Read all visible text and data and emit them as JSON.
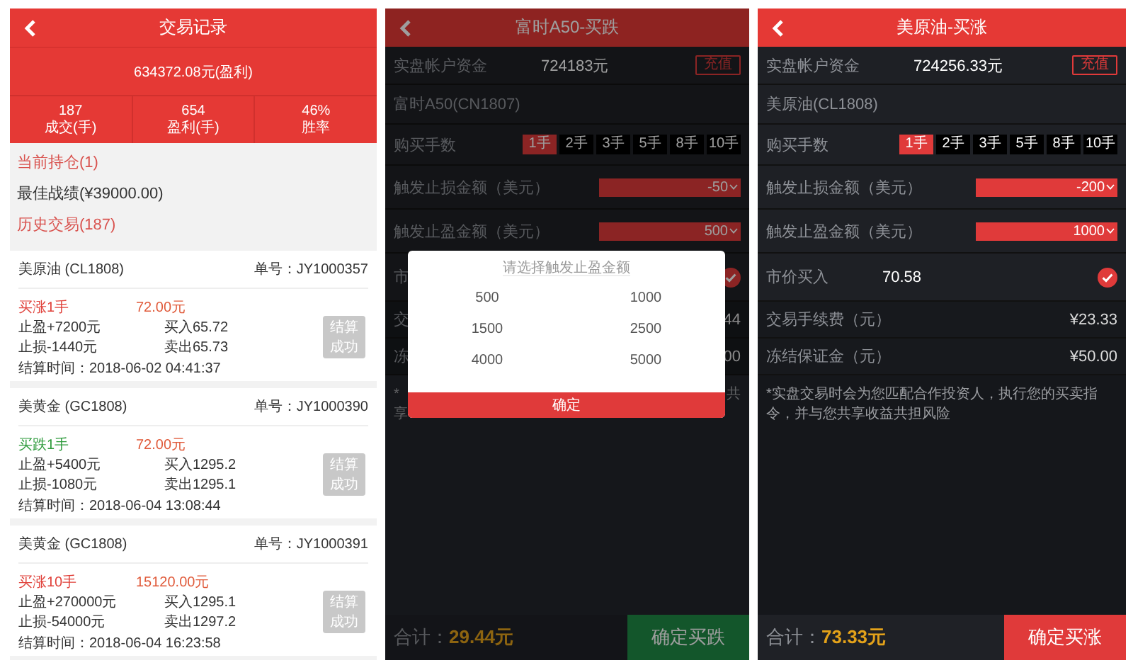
{
  "history": {
    "title": "交易记录",
    "total": "634372.08元(盈利)",
    "stats": [
      {
        "value": "187",
        "label": "成交(手)"
      },
      {
        "value": "654",
        "label": "盈利(手)"
      },
      {
        "value": "46%",
        "label": "胜率"
      }
    ],
    "links": [
      {
        "text": "当前持仓(1)",
        "kind": "link"
      },
      {
        "text": "最佳战绩(¥39000.00)",
        "kind": "plain"
      },
      {
        "text": "历史交易(187)",
        "kind": "link"
      }
    ],
    "orders": [
      {
        "product": "美原油 (CL1808)",
        "order_no": "单号：JY1000357",
        "direction": "买涨1手",
        "kind": "up",
        "amount": "72.00元",
        "take_profit": "止盈+7200元",
        "buy": "买入65.72",
        "stop_loss": "止损-1440元",
        "sell": "卖出65.73",
        "status": "结算成功",
        "settle_time": "结算时间：2018-06-02 04:41:37"
      },
      {
        "product": "美黄金 (GC1808)",
        "order_no": "单号：JY1000390",
        "direction": "买跌1手",
        "kind": "down",
        "amount": "72.00元",
        "take_profit": "止盈+5400元",
        "buy": "买入1295.2",
        "stop_loss": "止损-1080元",
        "sell": "卖出1295.1",
        "status": "结算成功",
        "settle_time": "结算时间：2018-06-04 13:08:44"
      },
      {
        "product": "美黄金 (GC1808)",
        "order_no": "单号：JY1000391",
        "direction": "买涨10手",
        "kind": "up",
        "amount": "15120.00元",
        "take_profit": "止盈+270000元",
        "buy": "买入1295.1",
        "stop_loss": "止损-54000元",
        "sell": "卖出1297.2",
        "status": "结算成功",
        "settle_time": "结算时间：2018-06-04 16:23:58"
      }
    ]
  },
  "forms": [
    {
      "title": "富时A50-买跌",
      "rows": [
        {
          "kind": "balance",
          "label": "实盘帐户资金",
          "value": "724183元",
          "button": "充值"
        },
        {
          "kind": "product",
          "label": "富时A50(CN1807)"
        },
        {
          "kind": "lots",
          "label": "购买手数",
          "options": [
            {
              "label": "1手",
              "selected": true
            },
            {
              "label": "2手",
              "selected": false
            },
            {
              "label": "3手",
              "selected": false
            },
            {
              "label": "5手",
              "selected": false
            },
            {
              "label": "8手",
              "selected": false
            },
            {
              "label": "10手",
              "selected": false
            }
          ]
        },
        {
          "kind": "select",
          "label": "触发止损金额（美元）",
          "value": "-50"
        },
        {
          "kind": "select",
          "label": "触发止盈金额（美元）",
          "value": "500"
        },
        {
          "kind": "market",
          "label": "市",
          "checked": true
        },
        {
          "kind": "info",
          "label": "交",
          "value": "44"
        },
        {
          "kind": "info",
          "label": "冻",
          "value": "00"
        },
        {
          "kind": "note_partial",
          "lines": [
            {
              "left": "*",
              "right": "共"
            },
            {
              "left": "享"
            }
          ]
        }
      ],
      "modal": {
        "title": "请选择触发止盈金额",
        "options": [
          {
            "label": "500",
            "selected": false
          },
          {
            "label": "1000",
            "selected": false
          },
          {
            "label": "1500",
            "selected": false
          },
          {
            "label": "2500",
            "selected": false
          },
          {
            "label": "4000",
            "selected": false
          },
          {
            "label": "5000",
            "selected": false
          }
        ],
        "button": "确定"
      },
      "footer": {
        "total_label": "合计：",
        "total": "29.44元",
        "button": "确定买跌",
        "kind": "fall"
      }
    },
    {
      "title": "美原油-买涨",
      "rows": [
        {
          "kind": "balance",
          "label": "实盘帐户资金",
          "value": "724256.33元",
          "button": "充值"
        },
        {
          "kind": "product",
          "label": "美原油(CL1808)"
        },
        {
          "kind": "lots",
          "label": "购买手数",
          "options": [
            {
              "label": "1手",
              "selected": true
            },
            {
              "label": "2手",
              "selected": false
            },
            {
              "label": "3手",
              "selected": false
            },
            {
              "label": "5手",
              "selected": false
            },
            {
              "label": "8手",
              "selected": false
            },
            {
              "label": "10手",
              "selected": false
            }
          ]
        },
        {
          "kind": "select",
          "label": "触发止损金额（美元）",
          "value": "-200"
        },
        {
          "kind": "select",
          "label": "触发止盈金额（美元）",
          "value": "1000"
        },
        {
          "kind": "market",
          "label": "市价买入",
          "value": "70.58",
          "checked": true
        },
        {
          "kind": "info",
          "label": "交易手续费（元）",
          "value": "¥23.33"
        },
        {
          "kind": "info",
          "label": "冻结保证金（元）",
          "value": "¥50.00"
        },
        {
          "kind": "note",
          "text": "*实盘交易时会为您匹配合作投资人，执行您的买卖指令，并与您共享收益共担风险"
        }
      ],
      "footer": {
        "total_label": "合计：",
        "total": "73.33元",
        "button": "确定买涨",
        "kind": "rise"
      }
    }
  ]
}
